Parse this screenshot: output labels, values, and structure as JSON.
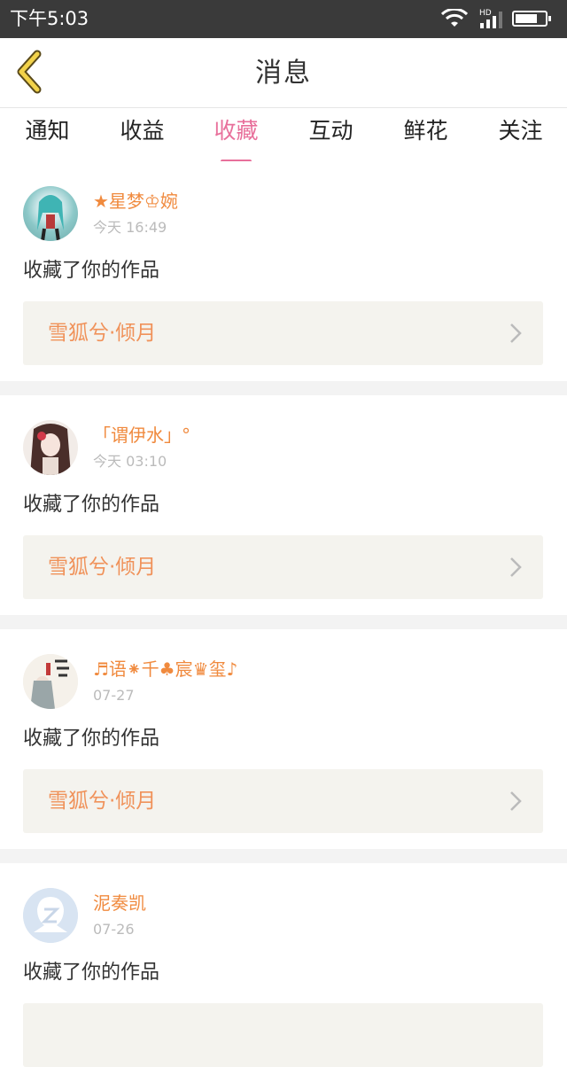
{
  "status_bar": {
    "time": "下午5:03",
    "network_label": "HD"
  },
  "header": {
    "title": "消息"
  },
  "tabs": [
    {
      "label": "通知"
    },
    {
      "label": "收益"
    },
    {
      "label": "收藏"
    },
    {
      "label": "互动"
    },
    {
      "label": "鲜花"
    },
    {
      "label": "关注"
    }
  ],
  "active_tab": "收藏",
  "messages": [
    {
      "username": "★星梦♔婉",
      "time": "今天 16:49",
      "action": "收藏了你的作品",
      "work_title": "雪狐兮·倾月"
    },
    {
      "username": "「谓伊水」°",
      "time": "今天 03:10",
      "action": "收藏了你的作品",
      "work_title": "雪狐兮·倾月"
    },
    {
      "username": "♬语⁕千♣宸♛玺♪",
      "time": "07-27",
      "action": "收藏了你的作品",
      "work_title": "雪狐兮·倾月"
    },
    {
      "username": "泥奏凯",
      "time": "07-26",
      "action": "收藏了你的作品",
      "work_title": ""
    }
  ],
  "colors": {
    "accent": "#e8709b",
    "username": "#f08a3e",
    "work_title": "#f0925a",
    "work_box_bg": "#f4f3ee",
    "status_bar_bg": "#3a3a3a"
  }
}
